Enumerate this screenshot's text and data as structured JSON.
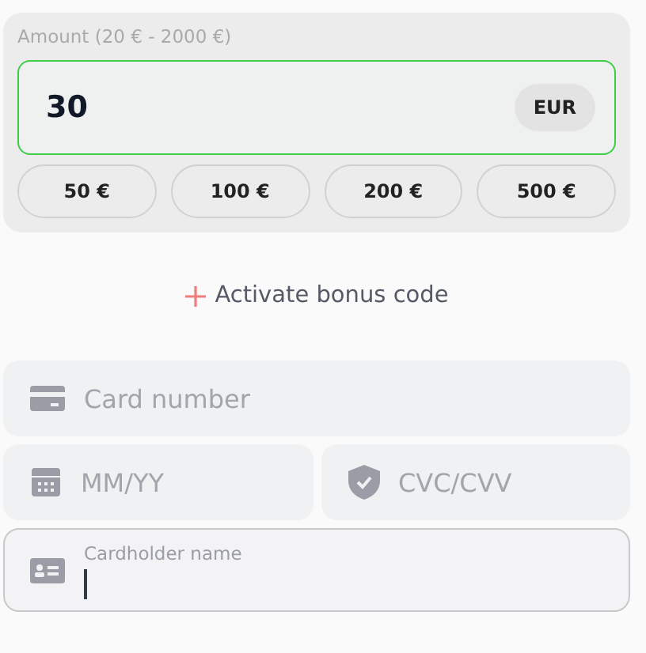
{
  "amount": {
    "label": "Amount (20 € - 2000 €)",
    "value": "30",
    "currency": "EUR",
    "valid": true
  },
  "presets": [
    "50 €",
    "100 €",
    "200 €",
    "500 €"
  ],
  "bonus": {
    "label": "Activate bonus code"
  },
  "fields": [
    {
      "kind": "card",
      "placeholder": "Card number",
      "focused": false
    },
    {
      "kind": "expiry",
      "placeholder": "MM/YY",
      "focused": false
    },
    {
      "kind": "cvc",
      "placeholder": "CVC/CVV",
      "focused": false
    },
    {
      "kind": "name",
      "label": "Cardholder name",
      "focused": true
    }
  ]
}
